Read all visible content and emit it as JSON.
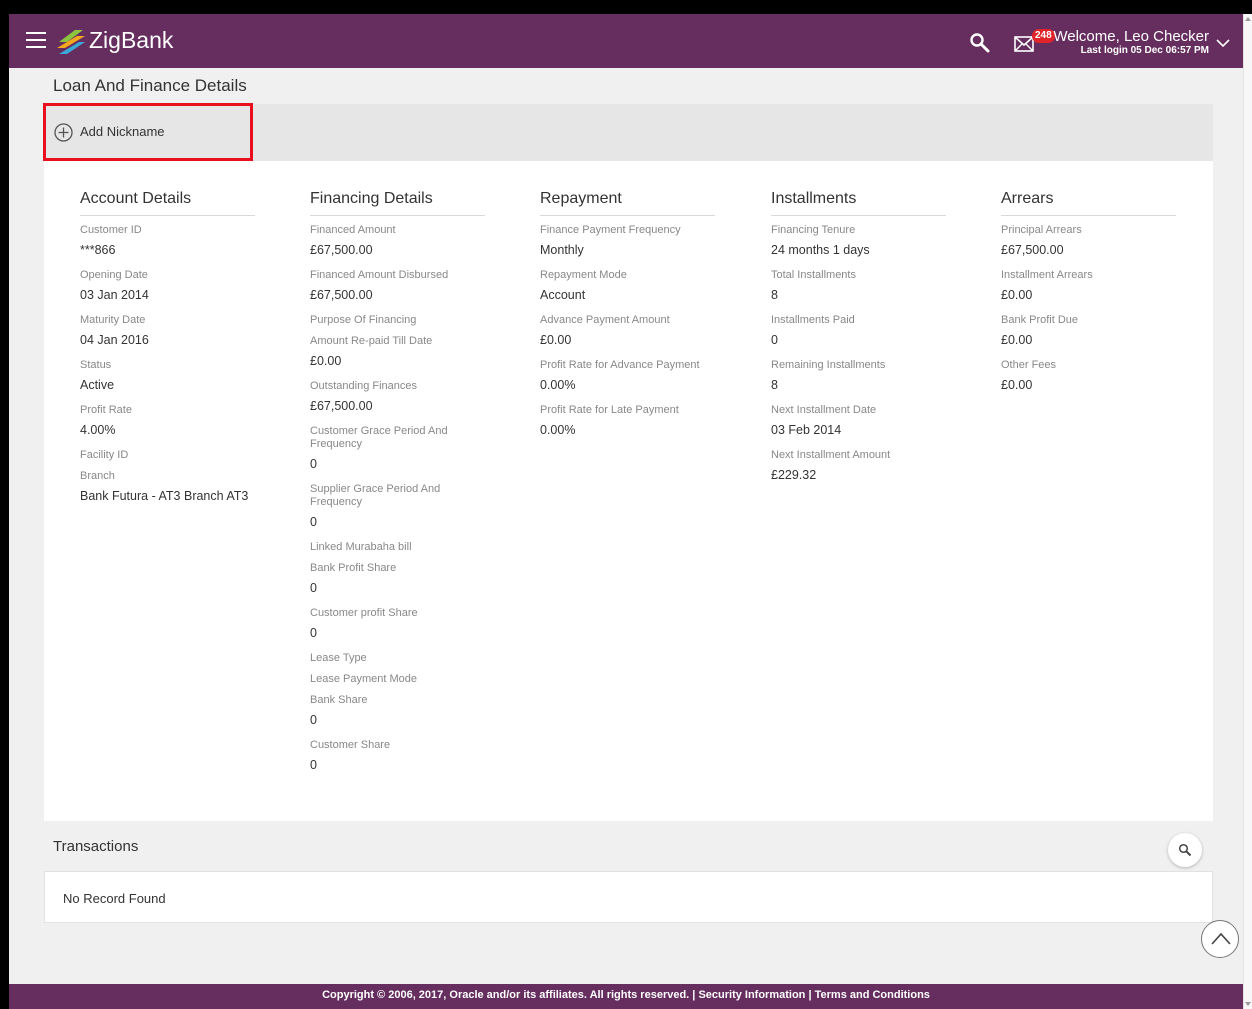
{
  "header": {
    "brand": "ZigBank",
    "notification_count": "248",
    "welcome": "Welcome, Leo Checker",
    "last_login": "Last login 05 Dec 06:57 PM",
    "bar_color": "#652e5f"
  },
  "page_title": "Loan And Finance Details",
  "nickname": {
    "label": "Add Nickname"
  },
  "sections": {
    "account": {
      "title": "Account Details",
      "fields": [
        {
          "label": "Customer ID",
          "value": "***866"
        },
        {
          "label": "Opening Date",
          "value": "03 Jan 2014"
        },
        {
          "label": "Maturity Date",
          "value": "04 Jan 2016"
        },
        {
          "label": "Status",
          "value": "Active"
        },
        {
          "label": "Profit Rate",
          "value": "4.00%"
        },
        {
          "label": "Facility ID",
          "value": ""
        },
        {
          "label": "Branch",
          "value": "Bank Futura - AT3 Branch AT3"
        }
      ]
    },
    "financing": {
      "title": "Financing Details",
      "fields": [
        {
          "label": "Financed Amount",
          "value": "£67,500.00"
        },
        {
          "label": "Financed Amount Disbursed",
          "value": "£67,500.00"
        },
        {
          "label": "Purpose Of Financing",
          "value": ""
        },
        {
          "label": "Amount Re-paid Till Date",
          "value": "£0.00"
        },
        {
          "label": "Outstanding Finances",
          "value": "£67,500.00"
        },
        {
          "label": "Customer Grace Period And Frequency",
          "value": "0"
        },
        {
          "label": "Supplier Grace Period And Frequency",
          "value": "0"
        },
        {
          "label": "Linked Murabaha bill",
          "value": ""
        },
        {
          "label": "Bank Profit Share",
          "value": "0"
        },
        {
          "label": "Customer profit Share",
          "value": "0"
        },
        {
          "label": "Lease Type",
          "value": ""
        },
        {
          "label": "Lease Payment Mode",
          "value": ""
        },
        {
          "label": "Bank Share",
          "value": "0"
        },
        {
          "label": "Customer Share",
          "value": "0"
        }
      ]
    },
    "repayment": {
      "title": "Repayment",
      "fields": [
        {
          "label": "Finance Payment Frequency",
          "value": "Monthly"
        },
        {
          "label": "Repayment Mode",
          "value": "Account"
        },
        {
          "label": "Advance Payment Amount",
          "value": "£0.00"
        },
        {
          "label": "Profit Rate for Advance Payment",
          "value": "0.00%"
        },
        {
          "label": "Profit Rate for Late Payment",
          "value": "0.00%"
        }
      ]
    },
    "installments": {
      "title": "Installments",
      "fields": [
        {
          "label": "Financing Tenure",
          "value": "24 months 1 days"
        },
        {
          "label": "Total Installments",
          "value": "8"
        },
        {
          "label": "Installments Paid",
          "value": "0"
        },
        {
          "label": "Remaining Installments",
          "value": "8"
        },
        {
          "label": "Next Installment Date",
          "value": "03 Feb 2014"
        },
        {
          "label": "Next Installment Amount",
          "value": "£229.32"
        }
      ]
    },
    "arrears": {
      "title": "Arrears",
      "fields": [
        {
          "label": "Principal Arrears",
          "value": "£67,500.00"
        },
        {
          "label": "Installment Arrears",
          "value": "£0.00"
        },
        {
          "label": "Bank Profit Due",
          "value": "£0.00"
        },
        {
          "label": "Other Fees",
          "value": "£0.00"
        }
      ]
    }
  },
  "transactions": {
    "title": "Transactions",
    "empty_message": "No Record Found"
  },
  "footer": {
    "copyright": "Copyright © 2006, 2017, Oracle and/or its affiliates. All rights reserved.",
    "separator": " | ",
    "security_link": "Security Information",
    "terms_link": "Terms and Conditions"
  },
  "icons": {
    "menu": "hamburger-menu-icon",
    "logo": "zigbank-logo-icon",
    "search": "search-icon",
    "mail": "mail-icon",
    "user_menu": "chevron-down-icon",
    "add": "plus-circle-icon",
    "scroll_top": "chevron-up-icon"
  }
}
